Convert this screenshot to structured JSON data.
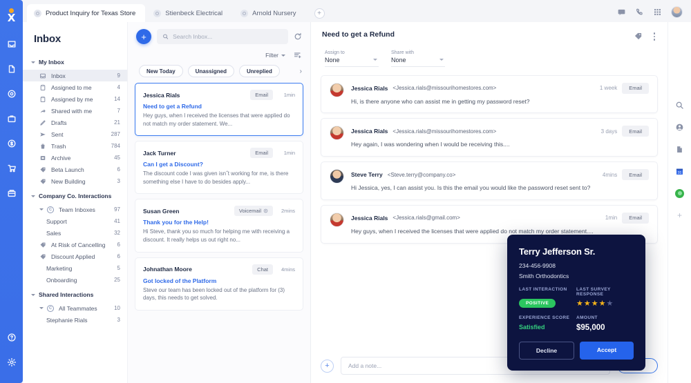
{
  "rail": {
    "logo": "logo-icon",
    "items": [
      {
        "name": "inbox-icon"
      },
      {
        "name": "document-icon"
      },
      {
        "name": "target-icon"
      },
      {
        "name": "briefcase-icon"
      },
      {
        "name": "dollar-icon"
      },
      {
        "name": "cart-icon"
      },
      {
        "name": "grid-icon"
      }
    ],
    "bottom": [
      {
        "name": "help-icon"
      },
      {
        "name": "settings-icon"
      }
    ]
  },
  "topbar": {
    "tabs": [
      {
        "label": "Product Inquiry for Texas Store",
        "active": true
      },
      {
        "label": "Stienbeck Electrical",
        "active": false
      },
      {
        "label": "Arnold Nursery",
        "active": false
      }
    ],
    "add_tab_label": "+",
    "icons": [
      "chat-icon",
      "phone-icon",
      "apps-grid-icon",
      "user-avatar"
    ]
  },
  "sidebar": {
    "title": "Inbox",
    "groups": [
      {
        "label": "My Inbox",
        "items": [
          {
            "label": "Inbox",
            "count": "9",
            "icon": "inbox-icon",
            "selected": true
          },
          {
            "label": "Assigned to me",
            "count": "4",
            "icon": "assigned-icon"
          },
          {
            "label": "Assigned by me",
            "count": "14",
            "icon": "assigned-icon"
          },
          {
            "label": "Shared with me",
            "count": "7",
            "icon": "share-icon"
          },
          {
            "label": "Drafts",
            "count": "21",
            "icon": "pencil-icon"
          },
          {
            "label": "Sent",
            "count": "287",
            "icon": "send-icon"
          },
          {
            "label": "Trash",
            "count": "784",
            "icon": "trash-icon"
          },
          {
            "label": "Archive",
            "count": "45",
            "icon": "archive-icon"
          },
          {
            "label": "Beta Launch",
            "count": "6",
            "icon": "tag-icon"
          },
          {
            "label": "New Building",
            "count": "3",
            "icon": "tag-icon"
          }
        ]
      },
      {
        "label": "Company Co. Interactions",
        "items": [
          {
            "label": "Team Inboxes",
            "count": "97",
            "icon": "group-icon",
            "level": 1
          },
          {
            "label": "Support",
            "count": "41",
            "icon": "none",
            "level": 2
          },
          {
            "label": "Sales",
            "count": "32",
            "icon": "none",
            "level": 2
          },
          {
            "label": "At Risk of Cancelling",
            "count": "6",
            "icon": "tag-icon",
            "level": 1
          },
          {
            "label": "Discount Applied",
            "count": "6",
            "icon": "tag-icon",
            "level": 1
          },
          {
            "label": "Marketing",
            "count": "5",
            "icon": "none",
            "level": 2
          },
          {
            "label": "Onboarding",
            "count": "25",
            "icon": "none",
            "level": 2
          }
        ]
      },
      {
        "label": "Shared Interactions",
        "items": [
          {
            "label": "All Teammates",
            "count": "10",
            "icon": "group-icon",
            "level": 1
          },
          {
            "label": "Stephanie Rials",
            "count": "3",
            "icon": "none",
            "level": 2
          }
        ]
      }
    ]
  },
  "list": {
    "compose_label": "+",
    "search_placeholder": "Search Inbox...",
    "search_value": "",
    "refresh_icon": "refresh-icon",
    "filter_label": "Filter",
    "sort_icon": "sort-add-icon",
    "chips": [
      "New Today",
      "Unassigned",
      "Unreplied"
    ],
    "chip_next": "›",
    "conversations": [
      {
        "name": "Jessica Rials",
        "badge": "Email",
        "time": "1min",
        "subject": "Need to get a Refund",
        "preview": "Hey guys, when I received the licenses that were applied do not match my order statement. We...",
        "selected": true
      },
      {
        "name": "Jack Turner",
        "badge": "Email",
        "time": "1min",
        "subject": "Can I get a Discount?",
        "preview": "The discount code I was given isn˝t working for me, is there something else I have to do besides apply...",
        "selected": false
      },
      {
        "name": "Susan Green",
        "badge": "Voicemail",
        "time": "2mins",
        "subject": "Thank you for the Help!",
        "preview": "Hi Steve, thank you so much for helping me with receiving a discount. It really helps us out right no...",
        "selected": false
      },
      {
        "name": "Johnathan Moore",
        "badge": "Chat",
        "time": "4mins",
        "subject": "Got locked of the Platform",
        "preview": "Steve our team has been locked out of the platform for (3) days, this needs to get solved.",
        "selected": false
      }
    ]
  },
  "thread": {
    "title": "Need to get a Refund",
    "tag_icon": "tag-icon",
    "menu_icon": "kebab-menu-icon",
    "assign_to": {
      "label": "Assign to",
      "value": "None"
    },
    "share_with": {
      "label": "Share with",
      "value": "None"
    },
    "messages": [
      {
        "name": "Jessica Rials",
        "email": "<Jessica.rials@missourihomestores.com>",
        "time": "1 week",
        "badge": "Email",
        "text": "Hi, is there anyone who can assist me in getting my password reset?",
        "avatar": "jessica"
      },
      {
        "name": "Jessica Rials",
        "email": "<Jessica.rials@missourihomestores.com>",
        "time": "3 days",
        "badge": "Email",
        "text": "Hey again, I was wondering when I would be receiving this....",
        "avatar": "jessica"
      },
      {
        "name": "Steve Terry",
        "email": "<Steve.terry@company.co>",
        "time": "4mins",
        "badge": "Email",
        "text": "Hi Jessica, yes, I can assist you.  Is this the email you would like the password reset sent to?",
        "avatar": "steve"
      },
      {
        "name": "Jessica Rials",
        "email": "<Jessica.rials@gmail.com>",
        "time": "1min",
        "badge": "Email",
        "text": "Hey guys, when I received the licenses that were applied do not match my order statement....",
        "avatar": "jessica"
      }
    ],
    "compose": {
      "plus_label": "+",
      "placeholder": "Add a note...",
      "value": "",
      "send_label": "Send",
      "icons": [
        "attach-icon",
        "emoji-icon",
        "mention-icon"
      ]
    }
  },
  "right_rail": {
    "items": [
      "search-icon",
      "contact-icon",
      "document-icon",
      "calendar-icon",
      "green-app-icon",
      "add-icon"
    ]
  },
  "contact_card": {
    "name": "Terry Jefferson Sr.",
    "phone": "234-456-9908",
    "company": "Smith Orthodontics",
    "last_interaction_label": "LAST INTERACTION",
    "last_interaction_value": "POSITIVE",
    "last_survey_label": "LAST SURVEY RESPONSE",
    "stars_filled": 4,
    "stars_total": 5,
    "experience_label": "EXPERIENCE SCORE",
    "experience_value": "Satisfied",
    "amount_label": "AMOUNT",
    "amount_value": "$95,000",
    "decline_label": "Decline",
    "accept_label": "Accept"
  },
  "colors": {
    "rail_blue": "#3a6ee8",
    "accent_blue": "#2f6ae8",
    "accept_blue": "#2563eb",
    "card_navy": "#0d1440",
    "positive_green": "#2bc55f",
    "star_gold": "#f5b31a"
  }
}
